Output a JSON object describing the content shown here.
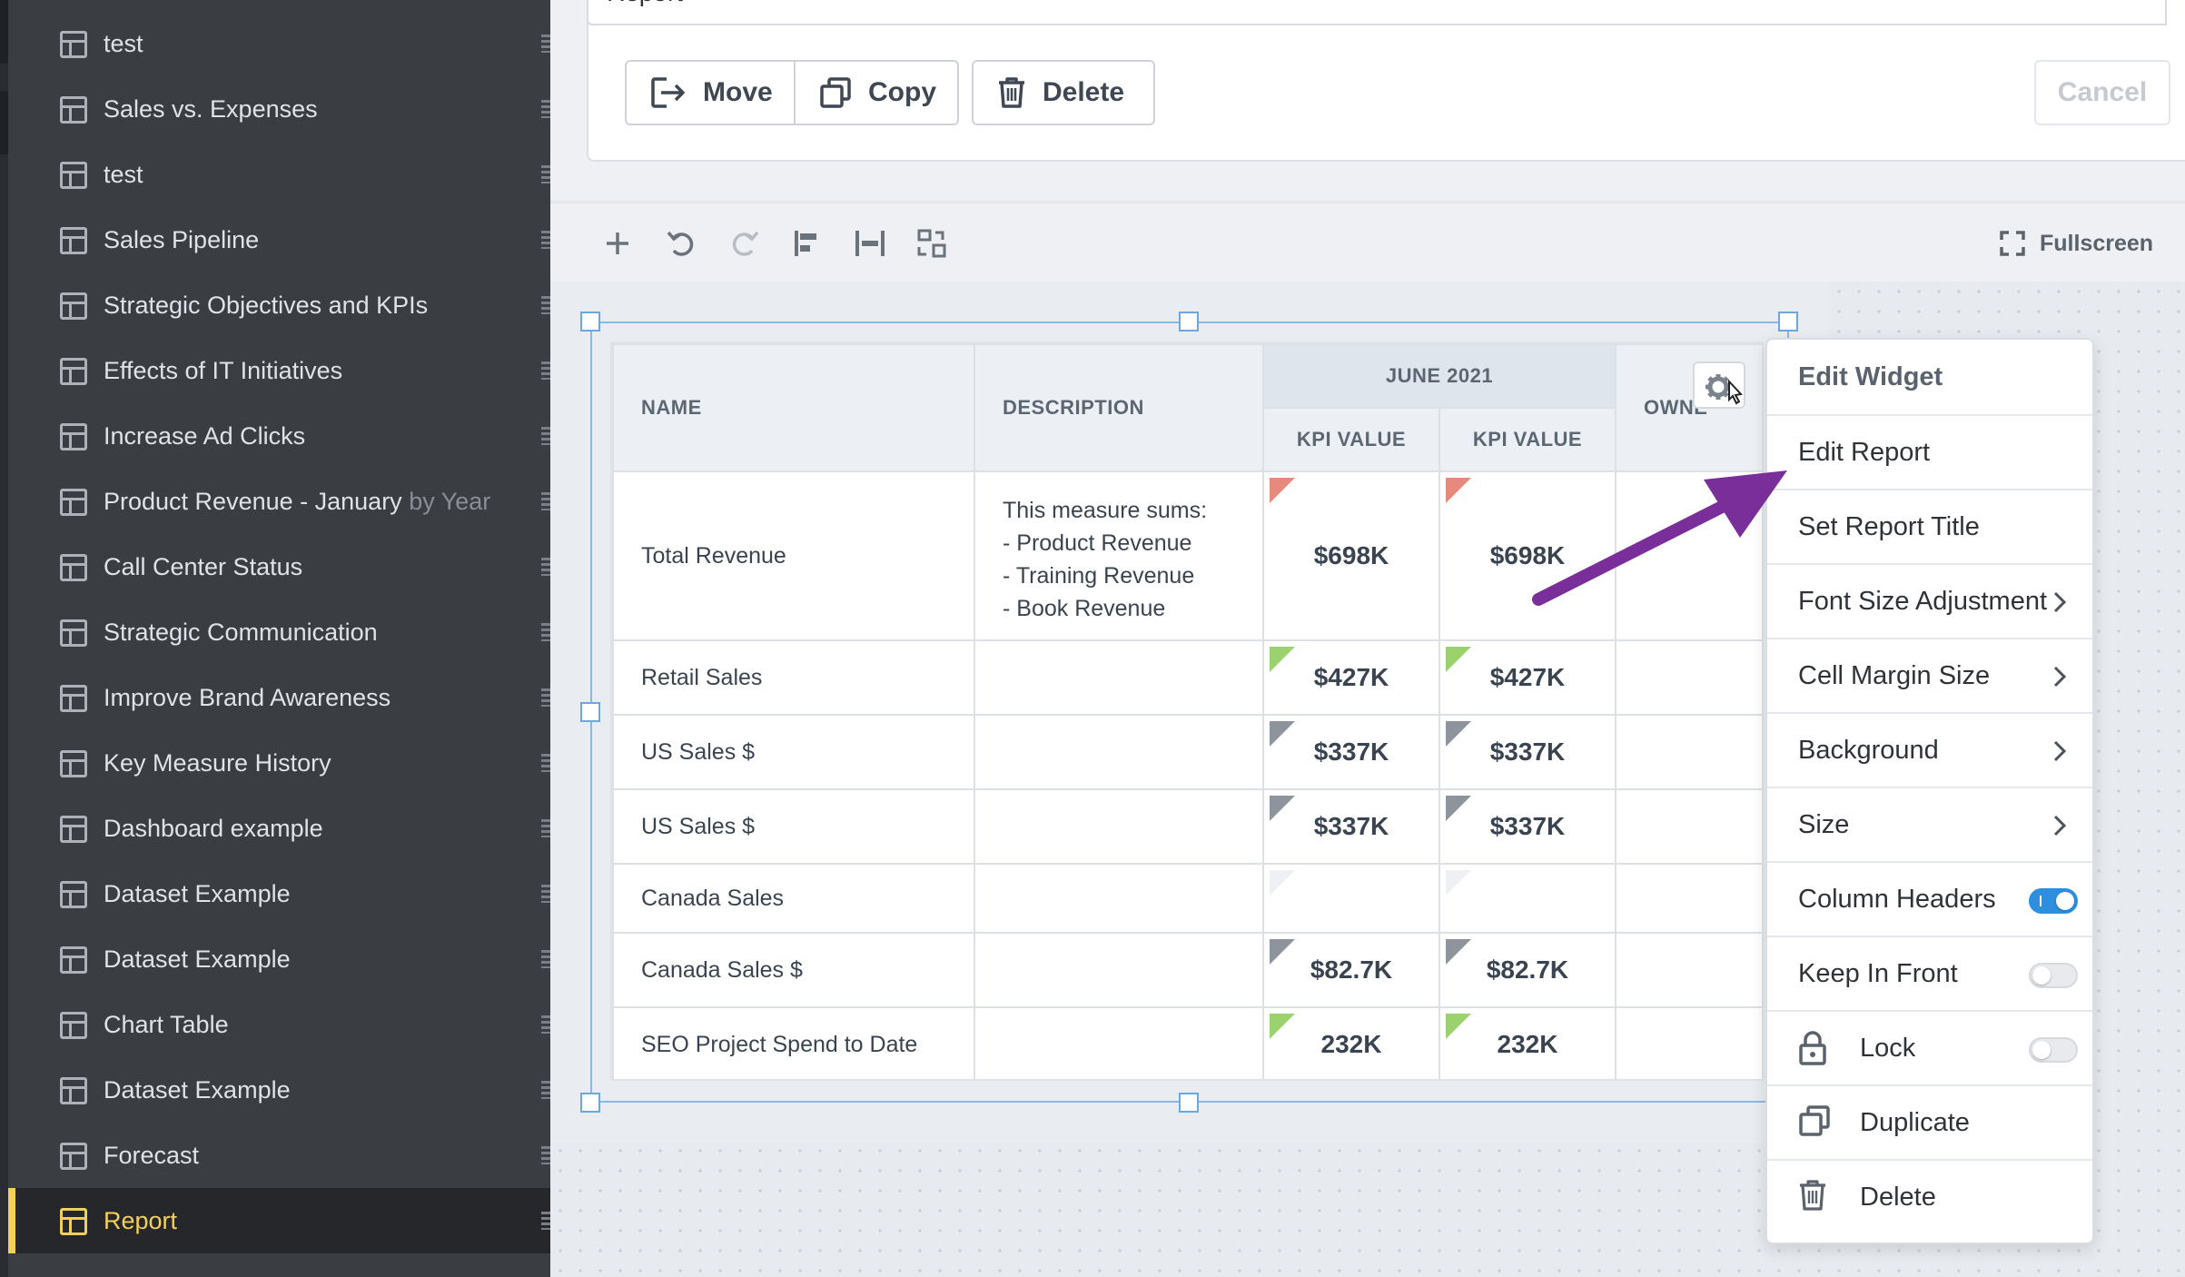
{
  "sidebar": {
    "items": [
      {
        "label": "test"
      },
      {
        "label": "Sales vs. Expenses"
      },
      {
        "label": "test"
      },
      {
        "label": "Sales Pipeline"
      },
      {
        "label": "Strategic Objectives and KPIs"
      },
      {
        "label": "Effects of IT Initiatives"
      },
      {
        "label": "Increase Ad Clicks"
      },
      {
        "label": "Product Revenue - January by Year"
      },
      {
        "label": "Call Center Status"
      },
      {
        "label": "Strategic Communication"
      },
      {
        "label": "Improve Brand Awareness"
      },
      {
        "label": "Key Measure History"
      },
      {
        "label": "Dashboard example"
      },
      {
        "label": "Dataset Example"
      },
      {
        "label": "Dataset Example"
      },
      {
        "label": "Chart Table"
      },
      {
        "label": "Dataset Example"
      },
      {
        "label": "Forecast"
      },
      {
        "label": "Report"
      }
    ],
    "active_index": 18,
    "active_color": "#f2d15b"
  },
  "top_panel": {
    "title_value": "Report",
    "move_label": "Move",
    "copy_label": "Copy",
    "delete_label": "Delete",
    "cancel_label": "Cancel"
  },
  "toolbar": {
    "fullscreen_label": "Fullscreen"
  },
  "table": {
    "headers": {
      "name": "NAME",
      "description": "DESCRIPTION",
      "period": "JUNE 2021",
      "kpi_value_1": "KPI VALUE",
      "kpi_value_2": "KPI VALUE",
      "owner": "OWNE"
    },
    "rows": [
      {
        "name": "Total Revenue",
        "desc": [
          "This measure sums:",
          "- Product Revenue",
          "- Training Revenue",
          "- Book Revenue"
        ],
        "v1": "$698K",
        "v2": "$698K",
        "flag": "red"
      },
      {
        "name": "Retail Sales",
        "desc": [],
        "v1": "$427K",
        "v2": "$427K",
        "flag": "green"
      },
      {
        "name": "US Sales $",
        "desc": [],
        "v1": "$337K",
        "v2": "$337K",
        "flag": "gray"
      },
      {
        "name": "US Sales $",
        "desc": [],
        "v1": "$337K",
        "v2": "$337K",
        "flag": "gray"
      },
      {
        "name": "Canada Sales",
        "desc": [],
        "v1": "",
        "v2": "",
        "flag": "light"
      },
      {
        "name": "Canada Sales $",
        "desc": [],
        "v1": "$82.7K",
        "v2": "$82.7K",
        "flag": "gray"
      },
      {
        "name": "SEO Project Spend to Date",
        "desc": [],
        "v1": "232K",
        "v2": "232K",
        "flag": "green"
      }
    ]
  },
  "menu": {
    "edit_widget": "Edit Widget",
    "edit_report": "Edit Report",
    "set_report_title": "Set Report Title",
    "font_size_adjustment": "Font Size Adjustment",
    "cell_margin_size": "Cell Margin Size",
    "background": "Background",
    "size": "Size",
    "column_headers": "Column Headers",
    "column_headers_on": true,
    "keep_in_front": "Keep In Front",
    "keep_in_front_on": false,
    "lock": "Lock",
    "lock_on": false,
    "duplicate": "Duplicate",
    "delete": "Delete"
  },
  "colors": {
    "annotation_arrow": "#7a2e9a",
    "toggle_on": "#2d8fdd",
    "flag_red": "#e8897d",
    "flag_green": "#9bd26e",
    "flag_gray": "#8d949c"
  }
}
